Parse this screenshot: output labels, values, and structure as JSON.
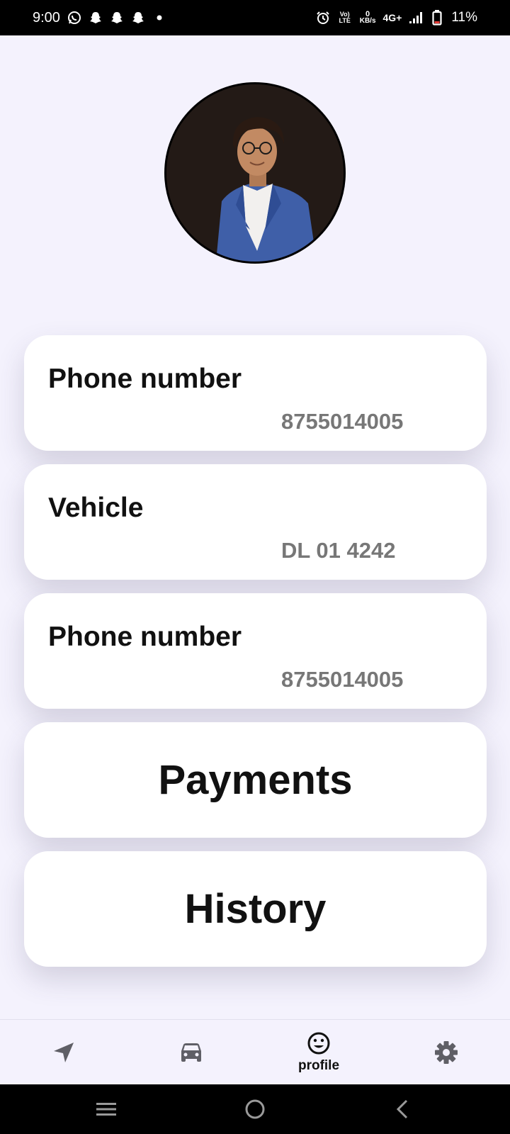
{
  "status_bar": {
    "time": "9:00",
    "network_lte": "Vo) LTE",
    "speed_value": "0",
    "speed_unit": "KB/s",
    "network_type": "4G+",
    "battery_percent": "11%",
    "icons": [
      "whatsapp-icon",
      "snapchat-icon",
      "snapchat-icon",
      "snapchat-icon",
      "dot-icon",
      "alarm-icon",
      "signal-icon",
      "battery-icon"
    ]
  },
  "profile": {
    "avatar": "avatar-icon"
  },
  "cards": [
    {
      "label": "Phone number",
      "value": "8755014005"
    },
    {
      "label": "Vehicle",
      "value": "DL 01 4242"
    },
    {
      "label": "Phone number",
      "value": "8755014005"
    }
  ],
  "buttons": {
    "payments": "Payments",
    "history": "History"
  },
  "bottom_nav": {
    "items": [
      {
        "icon": "navigation-arrow-icon",
        "label": ""
      },
      {
        "icon": "car-icon",
        "label": ""
      },
      {
        "icon": "smiley-icon",
        "label": "profile",
        "active": true
      },
      {
        "icon": "gear-icon",
        "label": ""
      }
    ]
  },
  "system_nav": {
    "icons": [
      "recents-icon",
      "home-icon",
      "back-icon"
    ]
  },
  "colors": {
    "background": "#f4f2fd",
    "card": "#ffffff",
    "label": "#111111",
    "value": "#777777",
    "icon": "#5f5f66"
  }
}
